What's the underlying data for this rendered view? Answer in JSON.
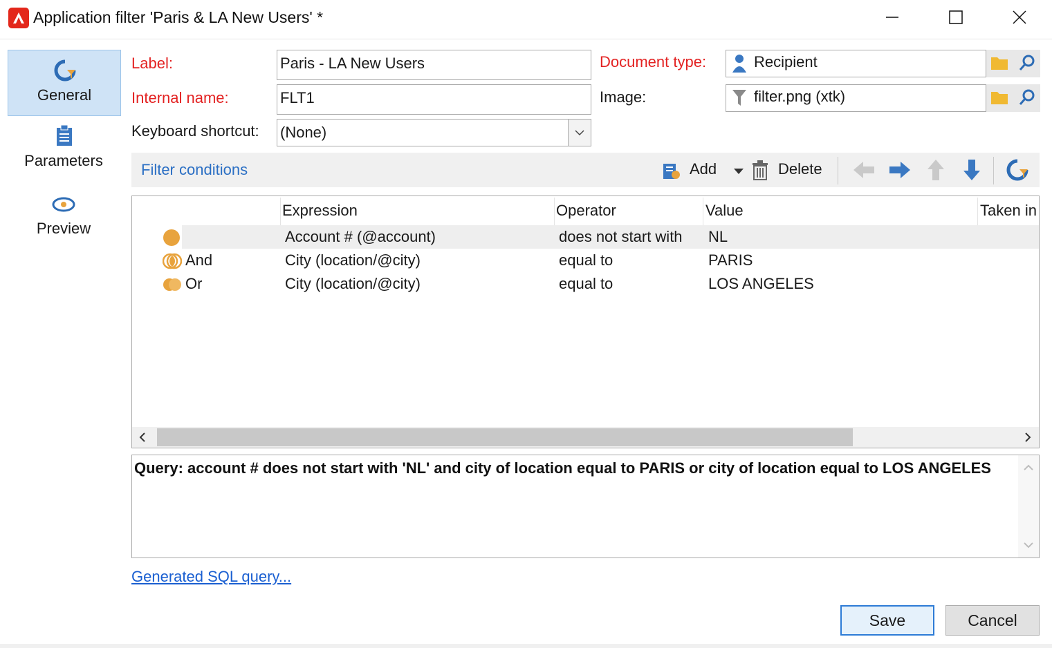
{
  "window": {
    "title": "Application filter 'Paris & LA New Users' *"
  },
  "sidebar": {
    "items": [
      {
        "label": "General"
      },
      {
        "label": "Parameters"
      },
      {
        "label": "Preview"
      }
    ]
  },
  "form": {
    "label_label": "Label:",
    "label_value": "Paris - LA New Users",
    "internal_name_label": "Internal name:",
    "internal_name_value": "FLT1",
    "shortcut_label": "Keyboard shortcut:",
    "shortcut_value": "(None)",
    "doctype_label": "Document type:",
    "doctype_value": "Recipient",
    "image_label": "Image:",
    "image_value": "filter.png (xtk)"
  },
  "toolbar": {
    "title": "Filter conditions",
    "add_label": "Add",
    "delete_label": "Delete"
  },
  "grid": {
    "columns": [
      "Expression",
      "Operator",
      "Value",
      "Taken in"
    ],
    "rows": [
      {
        "logic": "",
        "expression": "Account # (@account)",
        "operator": "does not start with",
        "value": "NL"
      },
      {
        "logic": "And",
        "expression": "City (location/@city)",
        "operator": "equal to",
        "value": "PARIS"
      },
      {
        "logic": "Or",
        "expression": "City (location/@city)",
        "operator": "equal to",
        "value": "LOS ANGELES"
      }
    ]
  },
  "query": {
    "text": "Query: account # does not start with 'NL' and city of location equal to PARIS or city of location equal to LOS ANGELES"
  },
  "links": {
    "sql": "Generated SQL query..."
  },
  "buttons": {
    "save": "Save",
    "cancel": "Cancel"
  },
  "colors": {
    "accent": "#2b6fc4",
    "required_label": "#e32222",
    "condition_dot": "#e8a33d"
  }
}
